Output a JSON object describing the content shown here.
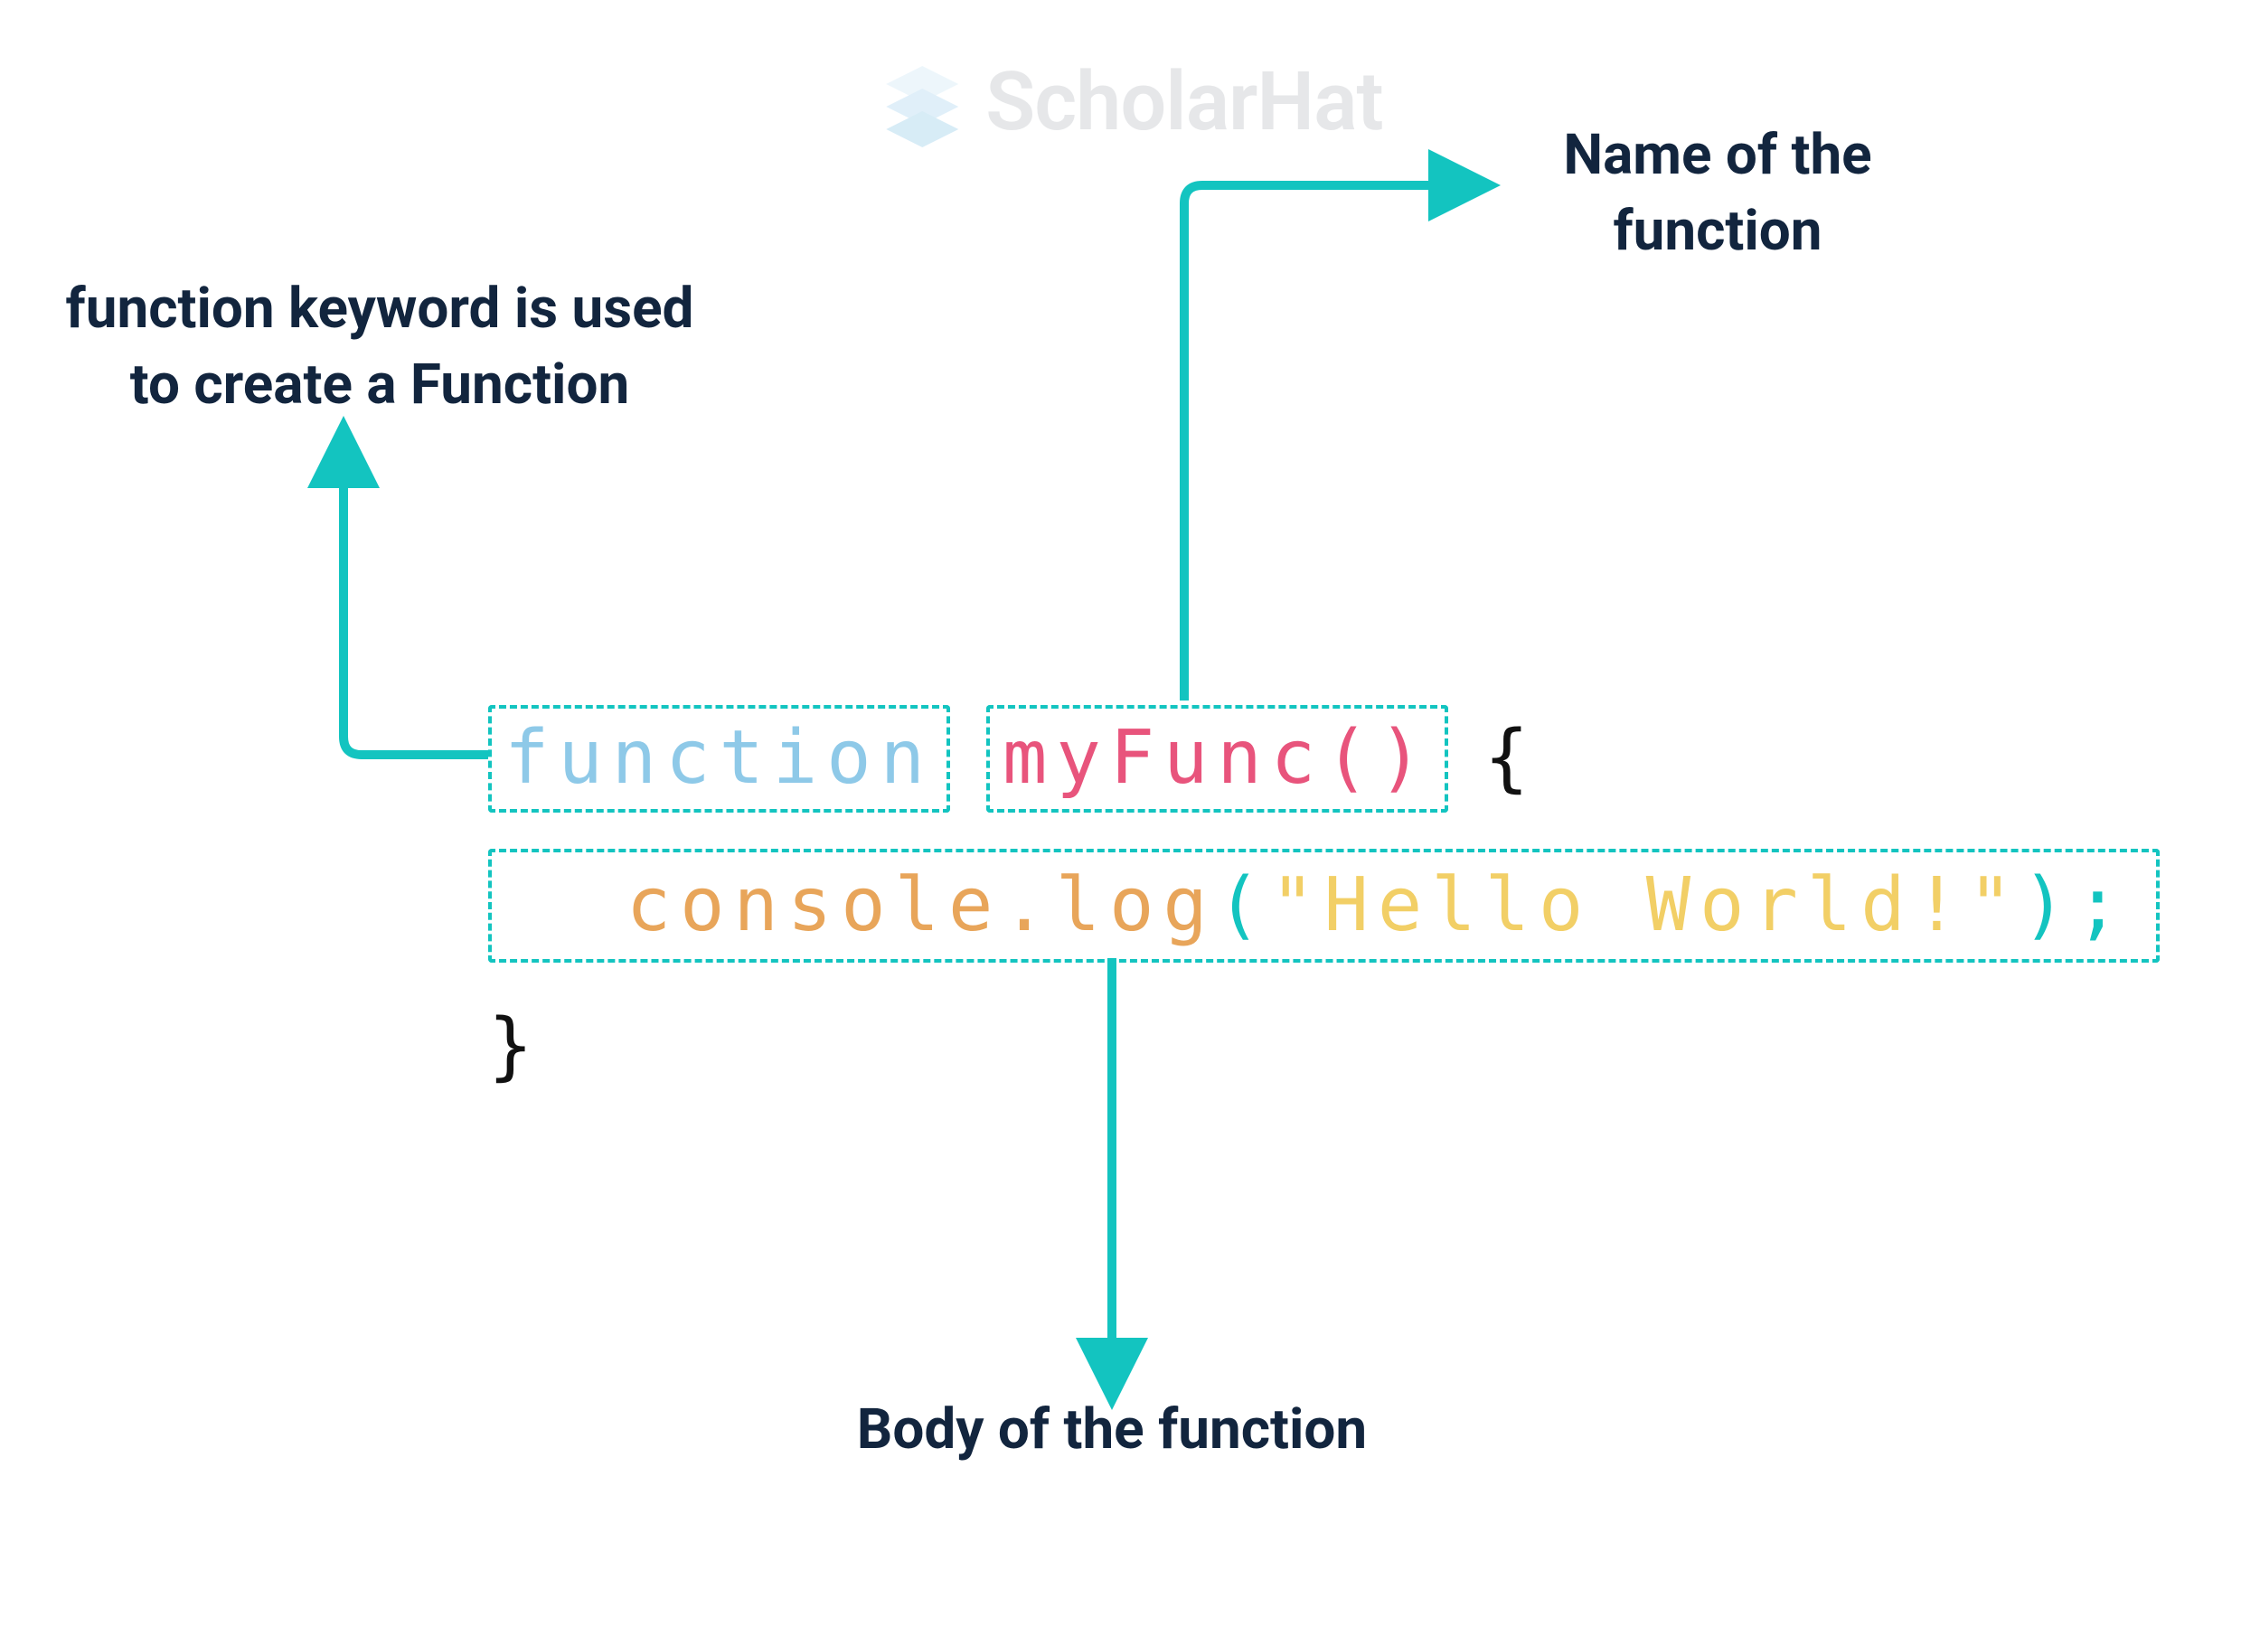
{
  "watermark": {
    "text": "ScholarHat"
  },
  "labels": {
    "keyword": "function keyword is used to create a Function",
    "name": "Name of the function",
    "body": "Body of the function"
  },
  "code": {
    "keyword": "function",
    "funcName": "myFunc()",
    "openBrace": "{",
    "bodyObj": "console.log",
    "bodyOpenParen": "(",
    "bodyString": "\"Hello World!\"",
    "bodyCloseParen": ")",
    "bodySemicolon": ";",
    "closeBrace": "}"
  },
  "colors": {
    "arrow": "#13c4c0",
    "label": "#12253e"
  }
}
